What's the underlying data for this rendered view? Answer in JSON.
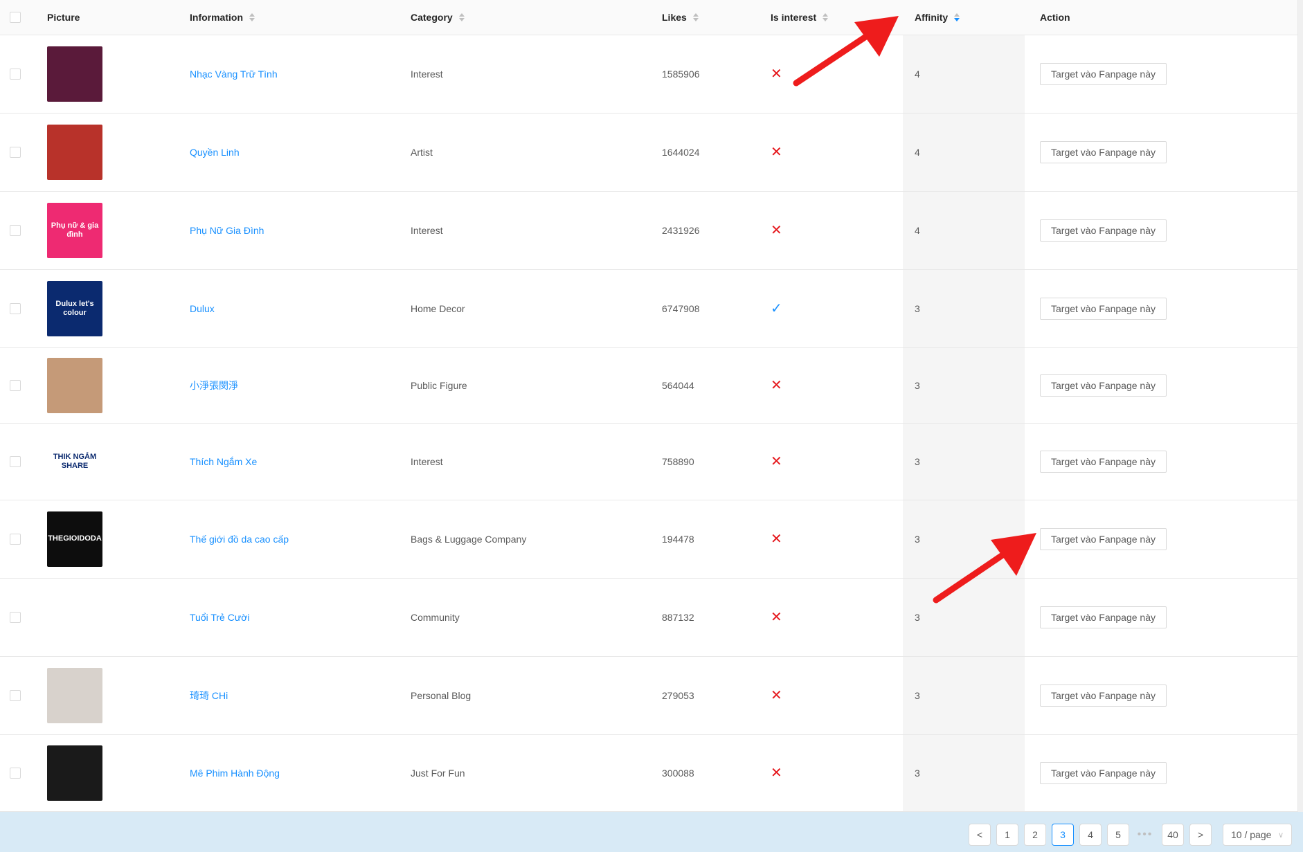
{
  "columns": {
    "picture": "Picture",
    "information": "Information",
    "category": "Category",
    "likes": "Likes",
    "is_interest": "Is interest",
    "affinity": "Affinity",
    "action": "Action"
  },
  "rows": [
    {
      "name": "Nhạc Vàng Trữ Tình",
      "category": "Interest",
      "likes": "1585906",
      "is_interest": false,
      "affinity": "4",
      "action": "Target vào Fanpage này",
      "thumb_color": "#5a1a3a",
      "thumb_text": ""
    },
    {
      "name": "Quyền Linh",
      "category": "Artist",
      "likes": "1644024",
      "is_interest": false,
      "affinity": "4",
      "action": "Target vào Fanpage này",
      "thumb_color": "#b8322a",
      "thumb_text": ""
    },
    {
      "name": "Phụ Nữ Gia Đình",
      "category": "Interest",
      "likes": "2431926",
      "is_interest": false,
      "affinity": "4",
      "action": "Target vào Fanpage này",
      "thumb_color": "#ee2a72",
      "thumb_text": "Phụ nữ & gia đình"
    },
    {
      "name": "Dulux",
      "category": "Home Decor",
      "likes": "6747908",
      "is_interest": true,
      "affinity": "3",
      "action": "Target vào Fanpage này",
      "thumb_color": "#0b2a6f",
      "thumb_text": "Dulux let's colour"
    },
    {
      "name": "小淨張閔淨",
      "category": "Public Figure",
      "likes": "564044",
      "is_interest": false,
      "affinity": "3",
      "action": "Target vào Fanpage này",
      "thumb_color": "#c59a78",
      "thumb_text": ""
    },
    {
      "name": "Thích Ngắm Xe",
      "category": "Interest",
      "likes": "758890",
      "is_interest": false,
      "affinity": "3",
      "action": "Target vào Fanpage này",
      "thumb_color": "#ffffff",
      "thumb_text": "THIK NGẮM SHARE"
    },
    {
      "name": "Thế giới đồ da cao cấp",
      "category": "Bags & Luggage Company",
      "likes": "194478",
      "is_interest": false,
      "affinity": "3",
      "action": "Target vào Fanpage này",
      "thumb_color": "#0d0d0d",
      "thumb_text": "THEGIOIDODA"
    },
    {
      "name": "Tuổi Trẻ Cười",
      "category": "Community",
      "likes": "887132",
      "is_interest": false,
      "affinity": "3",
      "action": "Target vào Fanpage này",
      "thumb_color": "#ffffff",
      "thumb_text": ""
    },
    {
      "name": "琦琦 CHi",
      "category": "Personal Blog",
      "likes": "279053",
      "is_interest": false,
      "affinity": "3",
      "action": "Target vào Fanpage này",
      "thumb_color": "#d8d2cc",
      "thumb_text": ""
    },
    {
      "name": "Mê Phim Hành Động",
      "category": "Just For Fun",
      "likes": "300088",
      "is_interest": false,
      "affinity": "3",
      "action": "Target vào Fanpage này",
      "thumb_color": "#1a1a1a",
      "thumb_text": ""
    }
  ],
  "pagination": {
    "prev": "<",
    "pages": [
      "1",
      "2",
      "3",
      "4",
      "5"
    ],
    "current": "3",
    "ellipsis": "•••",
    "last": "40",
    "next": ">",
    "page_size": "10 / page"
  },
  "colors": {
    "accent": "#1890ff",
    "no_mark": "#e5161b",
    "annotation_arrow": "#ee1c1c",
    "footer_bg": "#d8eaf6"
  },
  "icons": {
    "no": "x-mark-icon",
    "yes": "checkmark-icon",
    "sort": "sort-caret-icon",
    "annotation": "red-arrow-annotation"
  }
}
